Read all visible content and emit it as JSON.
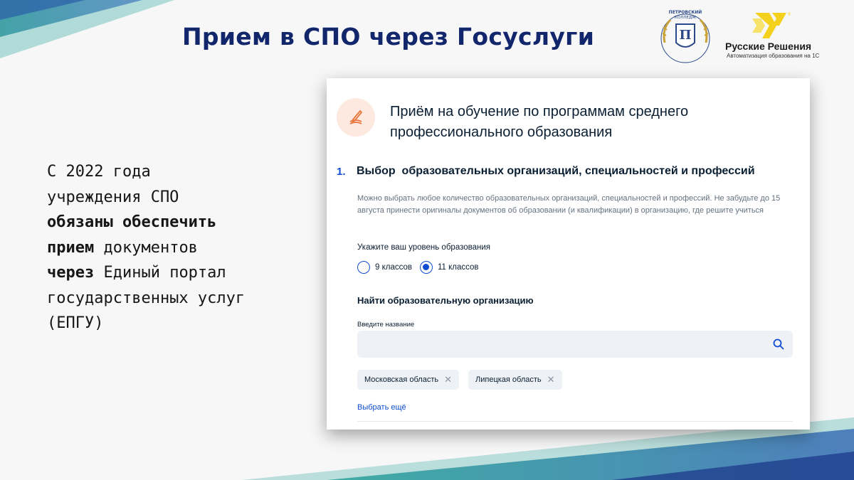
{
  "slide": {
    "title": "Прием в СПО через Госуслуги"
  },
  "logos": {
    "college_icon": "college-emblem",
    "rr_name": "Русские Решения",
    "rr_subtitle": "Автоматизация образования на 1С",
    "rr_mark": "®"
  },
  "left_text": {
    "line1": "С 2022 года",
    "line2": "учреждения СПО",
    "line3": "обязаны обеспечить",
    "line4_bold": "прием",
    "line4_rest": " документов",
    "line5_bold": "через",
    "line5_rest": " Единый портал",
    "line6": "государственных услуг",
    "line7": "(ЕПГУ)"
  },
  "card": {
    "icon": "pencil-book-icon",
    "title": "Приём на обучение по программам среднего профессионального образования",
    "step_number": "1.",
    "step_title": "Выбор  образовательных организаций, специальностей и профессий",
    "step_description": "Можно выбрать любое количество образовательных организаций, специальностей и профессий. Не забудьте до 15 августа принести оригиналы документов об образовании (и квалификации) в организацию, где решите учиться",
    "level_label": "Укажите ваш уровень образования",
    "level_options": [
      {
        "label": "9 классов",
        "checked": false
      },
      {
        "label": "11 классов",
        "checked": true
      }
    ],
    "find_title": "Найти образовательную организацию",
    "search_label": "Введите название",
    "search_value": "",
    "chips": [
      "Московская область",
      "Липецкая область"
    ],
    "more_link": "Выбрать ещё"
  },
  "colors": {
    "title_blue": "#12276b",
    "accent_blue": "#0d4cd3",
    "teal": "#2aa39b",
    "icon_bg": "#fde9df",
    "icon_orange": "#e8763d",
    "rr_yellow": "#f3d11c"
  }
}
